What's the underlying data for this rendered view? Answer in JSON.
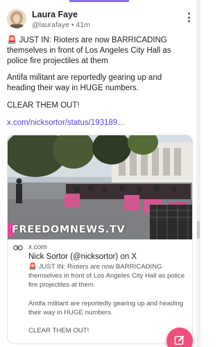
{
  "post": {
    "author_name": "Laura Faye",
    "author_handle": "@laurafaye",
    "separator": "•",
    "time_ago": "41m",
    "paragraph_1": "🚨 JUST IN: Rioters are now BARRICADING themselves in front of Los Angeles City Hall as police fire projectiles at them",
    "paragraph_2": "Antifa militant are reportedly gearing up and heading their way in HUGE numbers.",
    "paragraph_3": "CLEAR THEM OUT!",
    "link_text": "x.com/nicksortor/status/193189…"
  },
  "link_card": {
    "watermark": "FREEDOMNEWS.TV",
    "domain": "x.com",
    "title": "Nick Sortor (@nicksortor) on X",
    "desc_1": "🚨 JUST IN: Rioters are now BARRICADING themselves in front of Los Angeles City Hall as police fire projectiles at them",
    "desc_2": "Antifa militant are reportedly gearing up and heading their way in HUGE numbers.",
    "desc_3": "CLEAR THEM OUT!"
  },
  "icons": {
    "more": "kebab-vertical-icon",
    "link": "link-chain-icon",
    "compose": "compose-edit-icon"
  },
  "colors": {
    "accent": "#5b3fd6",
    "fab": "#ef4f7d",
    "watermark_box": "#e6459e"
  }
}
